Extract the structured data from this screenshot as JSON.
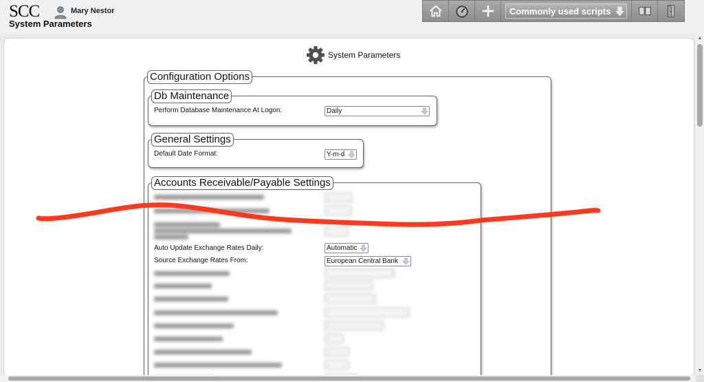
{
  "header": {
    "logo": "SCC",
    "user_name": "Mary Nestor",
    "page_heading": "System Parameters",
    "toolbar": {
      "buttons": [
        "home-icon",
        "speedometer-icon",
        "plus-icon"
      ],
      "scripts_label": "Commonly used scripts",
      "right_buttons": [
        "book-icon",
        "exit-door-icon"
      ]
    }
  },
  "page": {
    "title": "System Parameters",
    "title_icon": "gear-icon"
  },
  "config": {
    "legend": "Configuration Options",
    "db_maintenance": {
      "legend": "Db Maintenance",
      "label": "Perform Database Maintenance At Logon:",
      "value": "Daily"
    },
    "general_settings": {
      "legend": "General Settings",
      "label": "Default Date Format:",
      "value": "Y-m-d"
    },
    "ar_ap": {
      "legend": "Accounts Receivable/Payable Settings",
      "auto_update": {
        "label": "Auto Update Exchange Rates Daily:",
        "value": "Automatic"
      },
      "source_rates": {
        "label": "Source Exchange Rates From:",
        "value": "European Central Bank"
      }
    }
  },
  "annotation": {
    "color": "#ff3a1f",
    "description": "hand-drawn red strike line"
  }
}
